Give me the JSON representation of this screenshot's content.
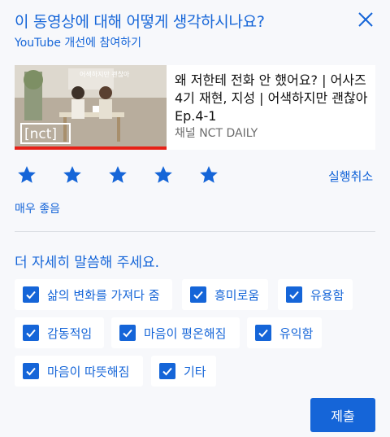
{
  "header": {
    "title": "이 동영상에 대해 어떻게 생각하시나요?",
    "subtitle": "YouTube 개선에 참여하기",
    "close_icon": "close-icon"
  },
  "video": {
    "title": "왜 저한테 전화 안 했어요? | 어사즈 4기 재현, 지성 | 어색하지만 괜찮아 Ep.4-1",
    "channel": "채널 NCT DAILY",
    "thumbnail_logo": "[nct]",
    "thumbnail_caption": "어색하지만 괜찮아"
  },
  "rating": {
    "stars_filled": 5,
    "stars_total": 5,
    "label": "매우 좋음",
    "undo_label": "실행취소",
    "accent": "#1565d8"
  },
  "details": {
    "prompt": "더 자세히 말씀해 주세요.",
    "options": [
      {
        "label": "삶의 변화를 가져다 줌",
        "checked": true
      },
      {
        "label": "흥미로움",
        "checked": true
      },
      {
        "label": "유용함",
        "checked": true
      },
      {
        "label": "감동적임",
        "checked": true
      },
      {
        "label": "마음이 평온해짐",
        "checked": true
      },
      {
        "label": "유익함",
        "checked": true
      },
      {
        "label": "마음이 따뜻해짐",
        "checked": true
      },
      {
        "label": "기타",
        "checked": true
      }
    ]
  },
  "submit_label": "제출"
}
